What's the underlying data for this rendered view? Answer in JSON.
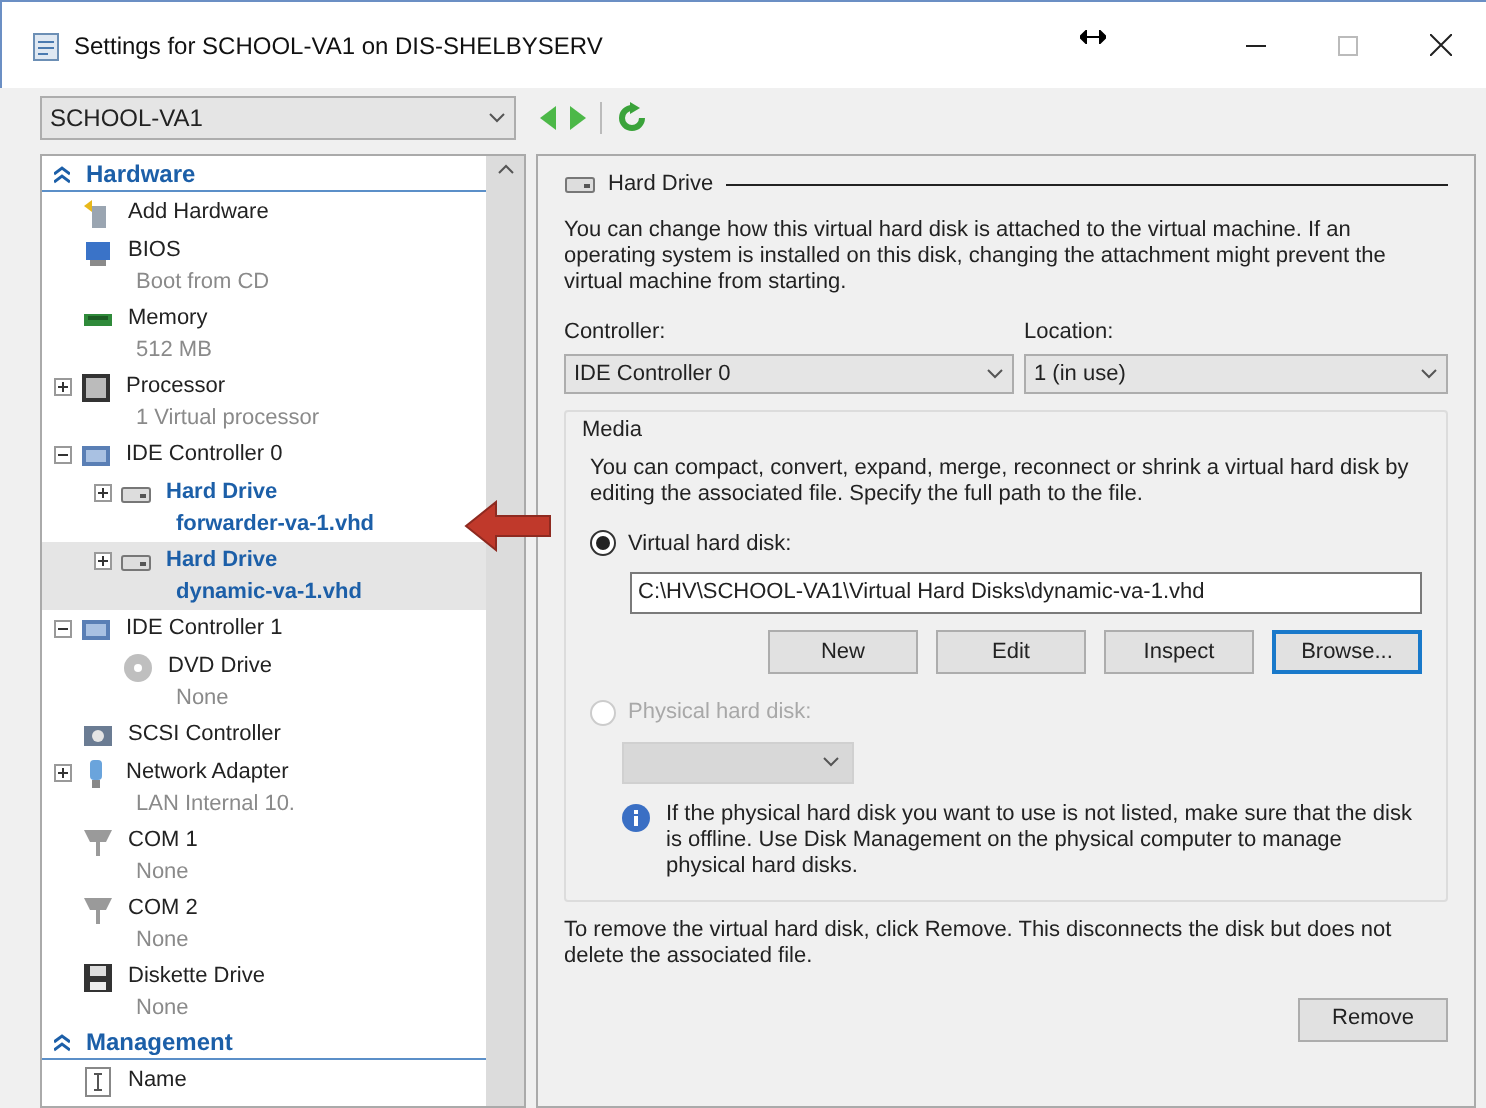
{
  "window": {
    "title": "Settings for SCHOOL-VA1 on DIS-SHELBYSERV"
  },
  "vm_selector": {
    "value": "SCHOOL-VA1"
  },
  "sidebar": {
    "items": [
      {
        "label": "Hardware",
        "children": [
          {
            "kind": "add",
            "label": "Add Hardware",
            "selected": false
          },
          {
            "kind": "bios",
            "label": "BIOS",
            "detail": "Boot from CD",
            "selected": false
          },
          {
            "kind": "memory",
            "label": "Memory",
            "detail": "512 MB",
            "selected": false
          },
          {
            "kind": "processor",
            "label": "Processor",
            "detail": "1 Virtual processor",
            "expanded": false,
            "selected": false
          },
          {
            "kind": "ide",
            "label": "IDE Controller 0",
            "expanded": true,
            "selected": false,
            "children": [
              {
                "kind": "disk",
                "label": "Hard Drive",
                "detail": "forwarder-va-1.vhd",
                "expanded": false,
                "selected": false
              },
              {
                "kind": "disk",
                "label": "Hard Drive",
                "detail": "dynamic-va-1.vhd",
                "expanded": false,
                "selected": true
              }
            ]
          },
          {
            "kind": "ide",
            "label": "IDE Controller 1",
            "expanded": true,
            "selected": false,
            "children": [
              {
                "kind": "dvd",
                "label": "DVD Drive",
                "detail": "None",
                "selected": false
              }
            ]
          },
          {
            "kind": "scsi",
            "label": "SCSI Controller",
            "selected": false
          },
          {
            "kind": "network",
            "label": "Network Adapter",
            "detail": "LAN Internal 10.",
            "expanded": false,
            "selected": false
          },
          {
            "kind": "com",
            "label": "COM 1",
            "detail": "None",
            "selected": false
          },
          {
            "kind": "com",
            "label": "COM 2",
            "detail": "None",
            "selected": false
          },
          {
            "kind": "floppy",
            "label": "Diskette Drive",
            "detail": "None",
            "selected": false
          }
        ]
      },
      {
        "label": "Management",
        "children": [
          {
            "kind": "name",
            "label": "Name",
            "selected": false
          }
        ]
      }
    ]
  },
  "details": {
    "heading": "Hard Drive",
    "intro": "You can change how this virtual hard disk is attached to the virtual machine. If an operating system is installed on this disk, changing the attachment might prevent the virtual machine from starting.",
    "controller": {
      "label": "Controller:",
      "value": "IDE Controller 0"
    },
    "location": {
      "label": "Location:",
      "value": "1 (in use)"
    },
    "media": {
      "legend": "Media",
      "text": "You can compact, convert, expand, merge, reconnect or shrink a virtual hard disk by editing the associated file. Specify the full path to the file.",
      "virtual": {
        "label": "Virtual hard disk:",
        "selected": true,
        "disabled": false
      },
      "path": "C:\\HV\\SCHOOL-VA1\\Virtual Hard Disks\\dynamic-va-1.vhd",
      "buttons": [
        {
          "label": "New",
          "focused": false
        },
        {
          "label": "Edit",
          "focused": false
        },
        {
          "label": "Inspect",
          "focused": false
        },
        {
          "label": "Browse...",
          "focused": true
        }
      ],
      "physical": {
        "label": "Physical hard disk:",
        "selected": false,
        "disabled": true
      },
      "info": "If the physical hard disk you want to use is not listed, make sure that the disk is offline. Use Disk Management on the physical computer to manage physical hard disks."
    },
    "remove_text": "To remove the virtual hard disk, click Remove. This disconnects the disk but does not delete the associated file.",
    "remove_button": "Remove"
  }
}
